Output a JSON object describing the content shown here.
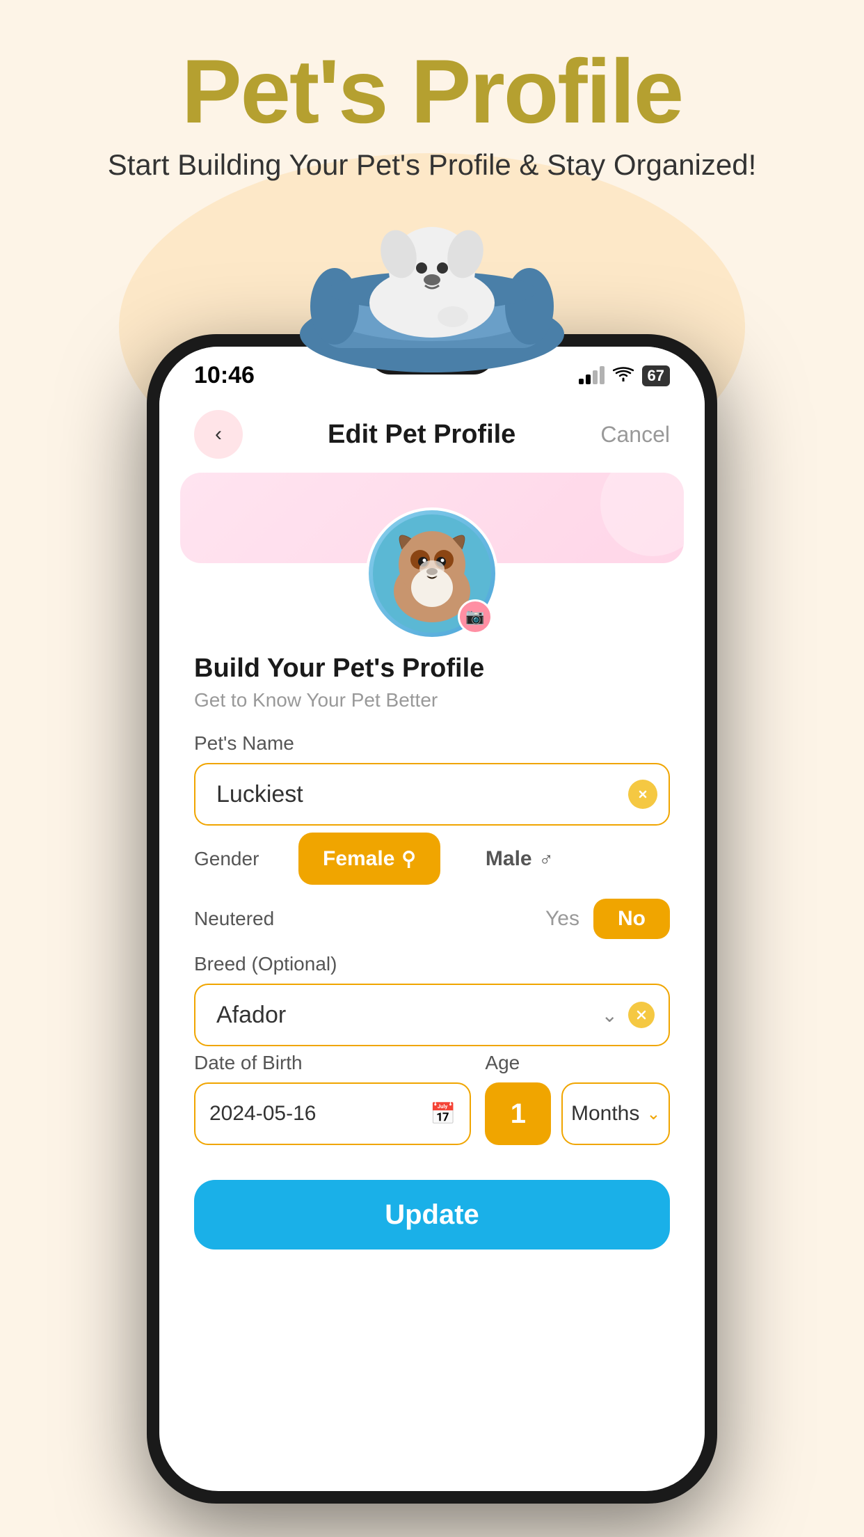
{
  "page": {
    "title": "Pet's Profile",
    "subtitle": "Start Building Your Pet's Profile & Stay Organized!",
    "background_color": "#fdf4e7"
  },
  "status_bar": {
    "time": "10:46",
    "battery": "67"
  },
  "nav": {
    "title": "Edit Pet Profile",
    "cancel_label": "Cancel"
  },
  "form": {
    "heading": "Build Your Pet's Profile",
    "subheading": "Get to Know Your Pet Better",
    "pet_name_label": "Pet's Name",
    "pet_name_value": "Luckiest",
    "gender_label": "Gender",
    "gender_female": "Female",
    "gender_male": "Male",
    "neutered_label": "Neutered",
    "neutered_yes": "Yes",
    "neutered_no": "No",
    "breed_label": "Breed (Optional)",
    "breed_value": "Afador",
    "dob_label": "Date of Birth",
    "dob_value": "2024-05-16",
    "age_label": "Age",
    "age_number": "1",
    "age_unit": "Months",
    "update_label": "Update"
  },
  "icons": {
    "back": "‹",
    "camera": "📷",
    "clear": "✕",
    "chevron_down": "⌄",
    "calendar": "📅",
    "female_symbol": "♀",
    "male_symbol": "♂"
  },
  "colors": {
    "accent": "#f0a500",
    "blue": "#1ab0e8",
    "pink_light": "#ffe4f0",
    "text_primary": "#1a1a1a",
    "text_secondary": "#999"
  }
}
